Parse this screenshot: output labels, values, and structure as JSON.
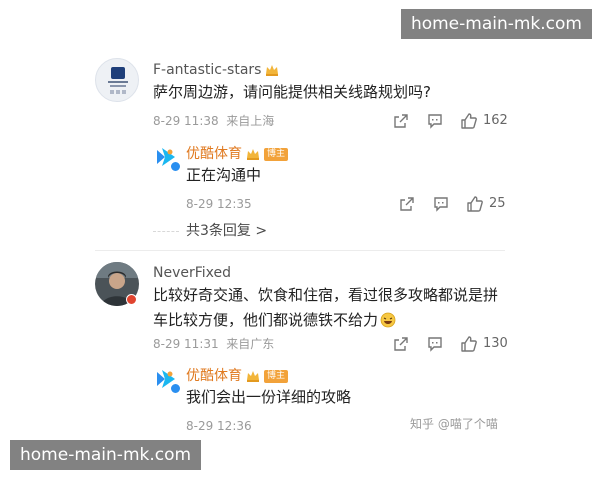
{
  "watermark": {
    "top_text": "home-main-mk.com",
    "bottom_text": "home-main-mk.com"
  },
  "comment1": {
    "author": "F-antastic-stars",
    "text": "萨尔周边游，请问能提供相关线路规划吗?",
    "time": "8-29 11:38",
    "location": "来自上海",
    "like_count": "162",
    "reply": {
      "author": "优酷体育",
      "badge": "博主",
      "text": "正在沟通中",
      "time": "8-29 12:35",
      "like_count": "25"
    },
    "more_replies": "共3条回复 >"
  },
  "comment2": {
    "author": "NeverFixed",
    "text_line1": "比较好奇交通、饮食和住宿，看过很多攻略都说是拼",
    "text_line2": "车比较方便，他们都说德铁不给力",
    "time": "8-29 11:31",
    "location": "来自广东",
    "like_count": "130",
    "reply": {
      "author": "优酷体育",
      "badge": "博主",
      "text": "我们会出一份详细的攻略",
      "time": "8-29 12:36"
    }
  },
  "zhihu_watermark": "知乎 @喵了个喵",
  "colors": {
    "reply_author": "#e07a20",
    "badge_bg": "#f2a23a",
    "verified_red": "#e0442f",
    "verified_blue": "#2a8ff0"
  },
  "icons": {
    "share": "share-icon",
    "comment": "comment-icon",
    "like": "thumbs-up-icon",
    "crown": "crown-icon",
    "emoji": "laughing-emoji-icon"
  }
}
